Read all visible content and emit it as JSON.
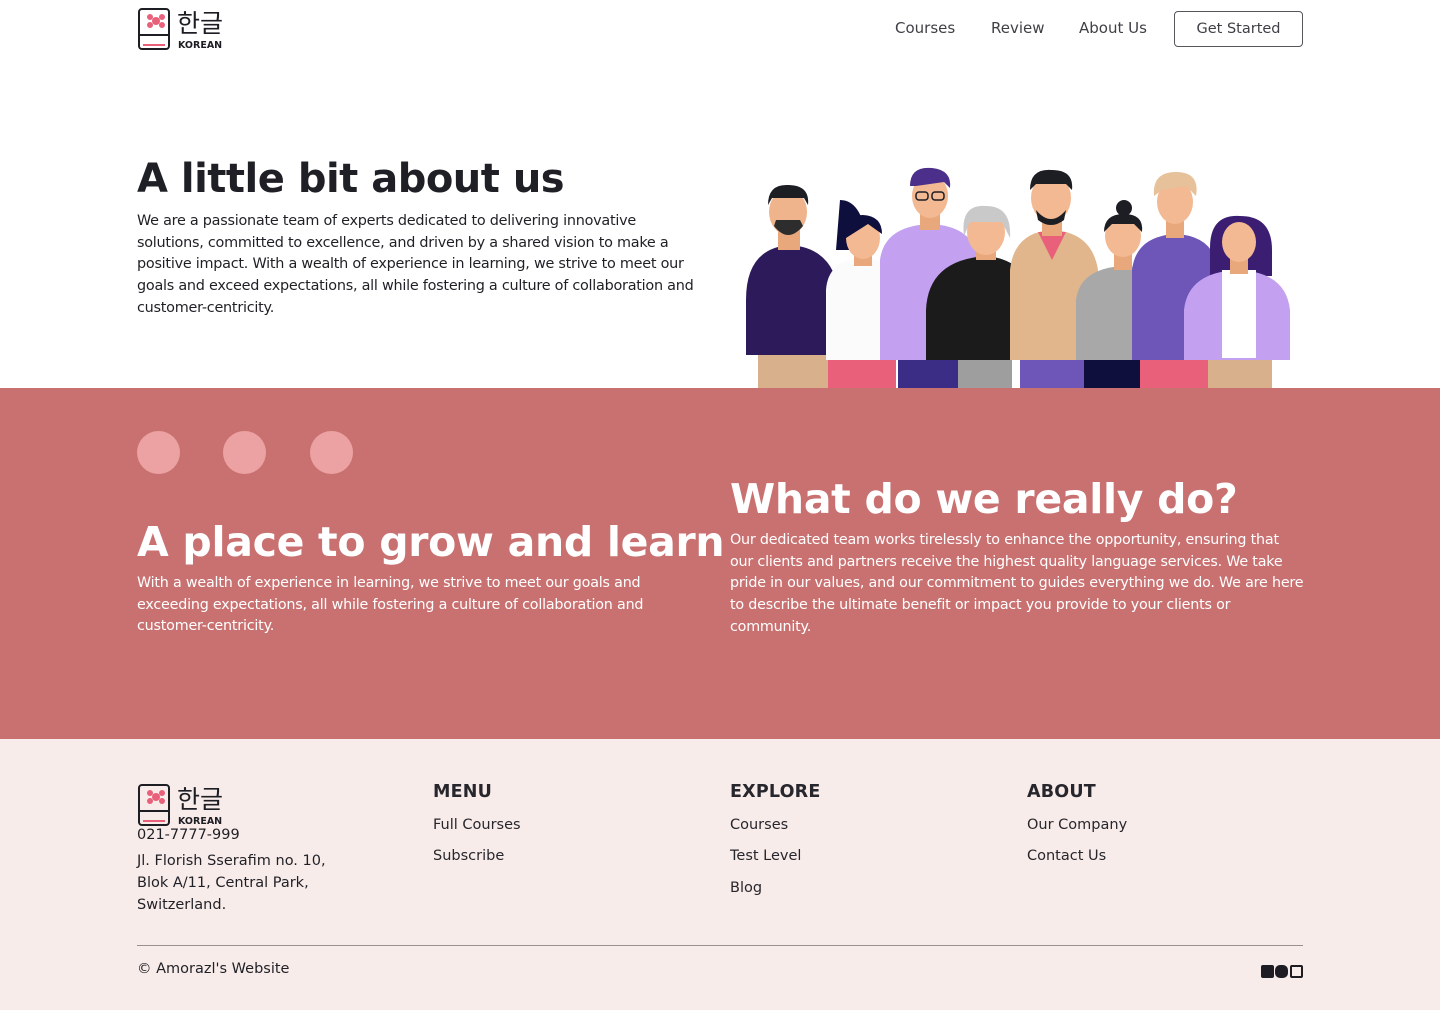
{
  "brand": {
    "hangul": "한글",
    "word": "KOREAN"
  },
  "nav": {
    "courses": "Courses",
    "review": "Review",
    "about": "About Us",
    "cta": "Get Started"
  },
  "about": {
    "title": "A little bit about us",
    "text": "We are a passionate team of experts dedicated to delivering innovative solutions, committed to excellence, and driven by a shared vision to make a positive impact. With a wealth of experience in learning, we strive to meet our goals and exceed expectations, all while fostering a culture of collaboration and customer-centricity."
  },
  "grow": {
    "title": "A place to grow and learn",
    "text": "With a wealth of experience in learning, we strive to meet our goals and exceeding expectations, all while fostering a culture of collaboration and customer-centricity."
  },
  "mission": {
    "title": "What do we really do?",
    "text": "Our dedicated team works tirelessly to enhance the opportunity, ensuring that our clients and partners receive the highest quality language services. We take pride in our values, and our commitment to guides everything we do. We are here to describe the ultimate benefit or impact you provide to your clients or community."
  },
  "footer": {
    "phone": "021-7777-999",
    "address": "Jl. Florish Sserafim no. 10, Blok A/11, Central Park, Switzerland.",
    "menu": {
      "heading": "MENU",
      "items": [
        "Full Courses",
        "Subscribe"
      ]
    },
    "explore": {
      "heading": "EXPLORE",
      "items": [
        "Courses",
        "Test Level",
        "Blog"
      ]
    },
    "about": {
      "heading": "ABOUT",
      "items": [
        "Our Company",
        "Contact Us"
      ]
    },
    "copyright": "© Amorazl's Website",
    "social": [
      "linkedin-icon",
      "blogger-icon",
      "instagram-icon"
    ]
  },
  "colors": {
    "band": "#c97171",
    "dots": "#eca2a2",
    "footer_bg": "#f8ecea",
    "accent": "#e8607a"
  }
}
